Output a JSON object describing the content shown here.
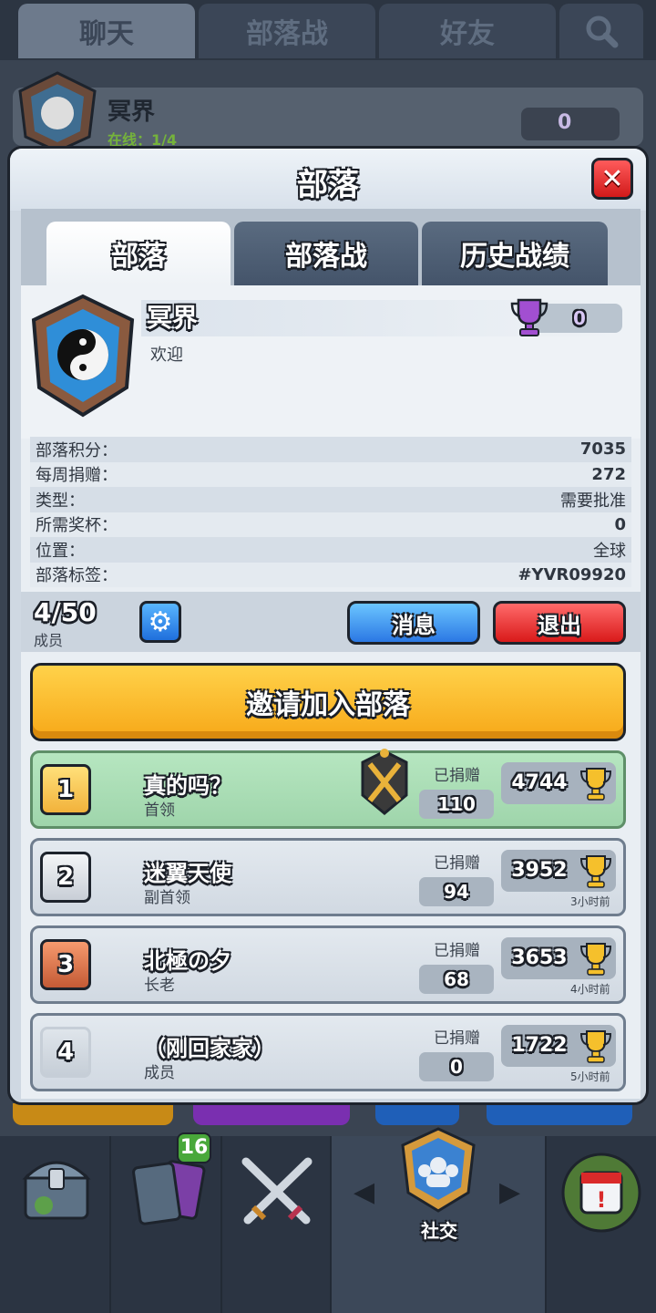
{
  "top_tabs": [
    {
      "label": "聊天",
      "active": true
    },
    {
      "label": "部落战",
      "active": false
    },
    {
      "label": "好友",
      "active": false
    }
  ],
  "background_clan": {
    "name": "冥界",
    "online": "在线：1/4",
    "trophies": "0"
  },
  "modal": {
    "title": "部落",
    "tabs": [
      {
        "label": "部落",
        "active": true
      },
      {
        "label": "部落战",
        "active": false
      },
      {
        "label": "历史战绩",
        "active": false
      }
    ],
    "clan": {
      "name": "冥界",
      "description": "欢迎",
      "trophies": "0"
    },
    "stats": [
      {
        "label": "部落积分：",
        "value": "7035"
      },
      {
        "label": "每周捐赠：",
        "value": "272"
      },
      {
        "label": "类型：",
        "value": "需要批准"
      },
      {
        "label": "所需奖杯：",
        "value": "0"
      },
      {
        "label": "位置：",
        "value": "全球"
      },
      {
        "label": "部落标签：",
        "value": "#YVR09920"
      }
    ],
    "members_count": "4/50",
    "members_label": "成员",
    "message_button": "消息",
    "leave_button": "退出",
    "invite_button": "邀请加入部落",
    "donated_label": "已捐赠",
    "members": [
      {
        "rank": "1",
        "name": "真的吗？",
        "role": "首领",
        "donated": "110",
        "trophies": "4744",
        "last_seen": ""
      },
      {
        "rank": "2",
        "name": "迷翼天使",
        "role": "副首领",
        "donated": "94",
        "trophies": "3952",
        "last_seen": "3小时前"
      },
      {
        "rank": "3",
        "name": "北極の夕",
        "role": "长老",
        "donated": "68",
        "trophies": "3653",
        "last_seen": "4小时前"
      },
      {
        "rank": "4",
        "name": "（刚回家家）",
        "role": "成员",
        "donated": "0",
        "trophies": "1722",
        "last_seen": "5小时前"
      }
    ]
  },
  "bottom_nav": {
    "active_label": "社交",
    "cards_badge": "16"
  },
  "colors": {
    "leader_row": "#a8dcb3",
    "invite": "#f7b529",
    "message": "#2b78e4",
    "leave": "#d91a1a",
    "close": "#e02424"
  }
}
